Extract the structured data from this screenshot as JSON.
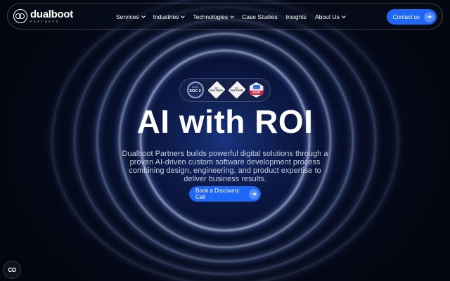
{
  "brand": {
    "name": "dualboot",
    "subtitle": "PARTNERS"
  },
  "nav": {
    "items": [
      {
        "label": "Services",
        "has_dropdown": true
      },
      {
        "label": "Industries",
        "has_dropdown": true
      },
      {
        "label": "Technologies",
        "has_dropdown": true
      },
      {
        "label": "Case Studies",
        "has_dropdown": false
      },
      {
        "label": "Insights",
        "has_dropdown": false
      },
      {
        "label": "About Us",
        "has_dropdown": true
      }
    ],
    "contact_label": "Contact us"
  },
  "badges": {
    "soc": {
      "line1": "AICPA",
      "line2": "SOC 2"
    },
    "partner1": {
      "line1": "aws",
      "line2": "PARTNER"
    },
    "partner2": {
      "line1": "aws",
      "line2": "PARTNER"
    },
    "aigp": {
      "label": "AIGP"
    }
  },
  "hero": {
    "title": "AI with ROI",
    "description": "Dualboot Partners builds powerful digital solutions through a proven AI-driven custom software development process combining design, engineering, and product expertise to deliver business results.",
    "cta_label": "Book a Discovery Call"
  },
  "chat": {
    "label": "CO"
  },
  "colors": {
    "accent": "#1e66f5",
    "background": "#04060f",
    "glow": "#6f9bff"
  },
  "icons": {
    "arrow": "arrow-right-icon",
    "chevron": "chevron-down-icon",
    "chat": "chat-widget-icon"
  }
}
